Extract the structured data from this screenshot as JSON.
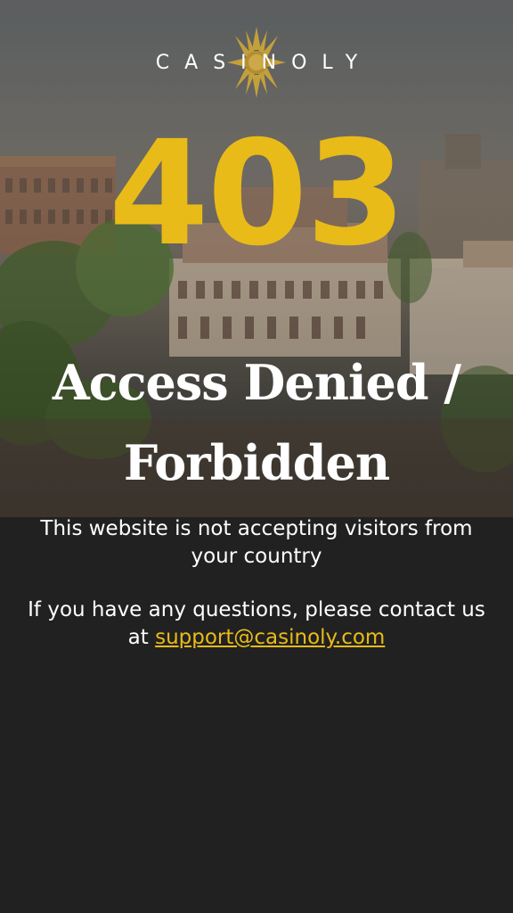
{
  "brand": {
    "name": "CASINOLY",
    "logo_icon": "sun-icon",
    "accent_color": "#e9bb18",
    "background_color": "#212121"
  },
  "error": {
    "code": "403",
    "title": "Access Denied / Forbidden",
    "message": "This website is not accepting visitors from your country",
    "contact_prefix": "If you have any questions, please contact us at",
    "contact_email": "support@casinoly.com"
  }
}
